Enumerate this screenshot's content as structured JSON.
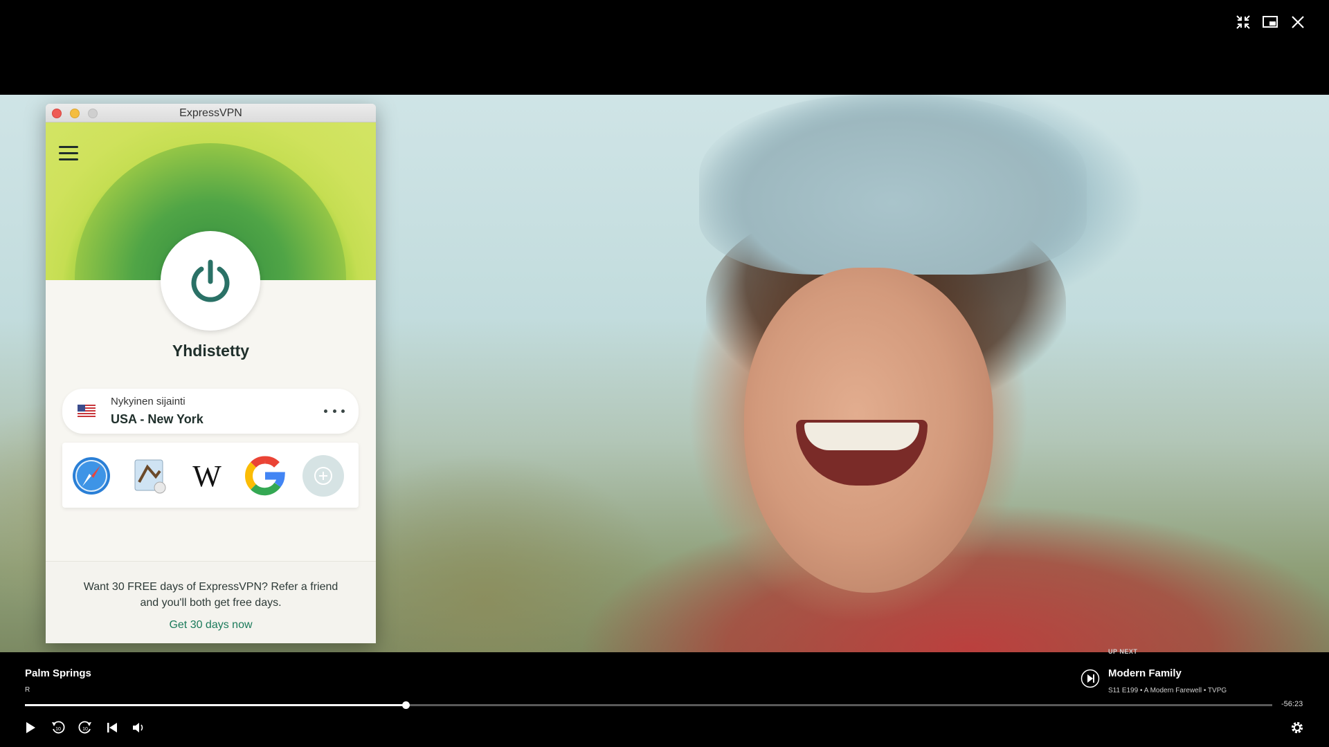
{
  "vpn": {
    "window_title": "ExpressVPN",
    "status": "Yhdistetty",
    "location": {
      "label": "Nykyinen sijainti",
      "value": "USA - New York"
    },
    "shortcuts": [
      "safari-icon",
      "mail-icon",
      "wikipedia-icon",
      "google-icon",
      "add-shortcut-icon"
    ],
    "wikipedia_glyph": "W",
    "referral": {
      "text": "Want 30 FREE days of ExpressVPN? Refer a friend and you'll both get free days.",
      "link": "Get 30 days now"
    },
    "colors": {
      "accent_green": "#2f8a3f",
      "hero_yellow_green": "#c5de52",
      "link_green": "#1a7a5a"
    }
  },
  "player": {
    "title": "Palm Springs",
    "rating": "R",
    "up_next": {
      "label": "UP NEXT",
      "title": "Modern Family",
      "meta": "S11 E199 • A Modern Farewell • TVPG"
    },
    "time_remaining": "-56:23",
    "progress": 0.305
  },
  "window_controls": [
    "exit-fullscreen-icon",
    "picture-in-picture-icon",
    "close-icon"
  ]
}
